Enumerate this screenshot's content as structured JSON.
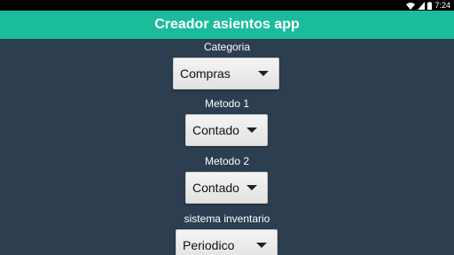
{
  "status_bar": {
    "time": "7:24",
    "icons": [
      "wifi-icon",
      "signal-icon",
      "battery-icon"
    ]
  },
  "app_bar": {
    "title": "Creador asientos app"
  },
  "form": {
    "categoria": {
      "label": "Categoria",
      "value": "Compras"
    },
    "metodo1": {
      "label": "Metodo 1",
      "value": "Contado"
    },
    "metodo2": {
      "label": "Metodo 2",
      "value": "Contado"
    },
    "sistema": {
      "label": "sistema inventario",
      "value": "Periodico"
    }
  },
  "colors": {
    "background": "#2c3e50",
    "app_bar": "#1abc9c",
    "status_bar": "#000000"
  }
}
